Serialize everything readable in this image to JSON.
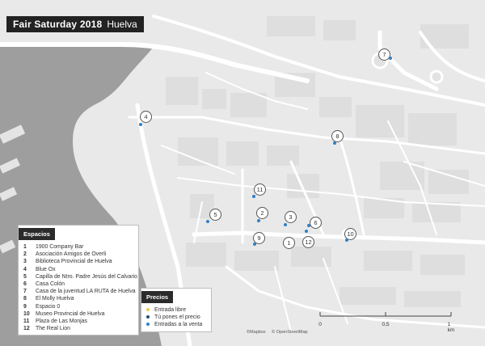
{
  "title": {
    "main": "Fair Saturday 2018",
    "city": "Huelva"
  },
  "legend": {
    "heading": "Espacios",
    "items": [
      {
        "num": "1",
        "name": "1900 Company Bar"
      },
      {
        "num": "2",
        "name": "Asociación Amigos de Overli"
      },
      {
        "num": "3",
        "name": "Biblioteca Provincial de Huelva"
      },
      {
        "num": "4",
        "name": "Blue Ox"
      },
      {
        "num": "5",
        "name": "Capilla de Ntro. Padre Jesús del Calvario"
      },
      {
        "num": "6",
        "name": "Casa Colón"
      },
      {
        "num": "7",
        "name": "Casa de la juventud LA RUTA de Huelva"
      },
      {
        "num": "8",
        "name": "El Molly Huelva"
      },
      {
        "num": "9",
        "name": "Espacio 0"
      },
      {
        "num": "10",
        "name": "Museo Provincial de Huelva"
      },
      {
        "num": "11",
        "name": "Plaza de Las Monjas"
      },
      {
        "num": "12",
        "name": "The Real Lion"
      }
    ]
  },
  "prices": {
    "heading": "Precios",
    "items": [
      {
        "label": "Entrada libre",
        "color": "#f2c94c"
      },
      {
        "label": "Tú pones el precio",
        "color": "#1f4e79"
      },
      {
        "label": "Entradas a la venta",
        "color": "#2f80c6"
      }
    ]
  },
  "markers": [
    {
      "num": "1",
      "price": "Entrada libre"
    },
    {
      "num": "2",
      "price": "Entradas a la venta"
    },
    {
      "num": "3",
      "price": "Entradas a la venta"
    },
    {
      "num": "4",
      "price": "Entradas a la venta"
    },
    {
      "num": "5",
      "price": "Entradas a la venta"
    },
    {
      "num": "6",
      "price": "Entradas a la venta"
    },
    {
      "num": "7",
      "price": "Entradas a la venta"
    },
    {
      "num": "8",
      "price": "Entradas a la venta"
    },
    {
      "num": "9",
      "price": "Entradas a la venta"
    },
    {
      "num": "10",
      "price": "Entradas a la venta"
    },
    {
      "num": "11",
      "price": "Entradas a la venta"
    },
    {
      "num": "12",
      "price": "Entradas a la venta"
    }
  ],
  "scale": {
    "labels": [
      "0",
      "0,5",
      "1 km"
    ]
  },
  "attribution": [
    "©Mapbox",
    "© OpenStreetMap"
  ],
  "colors": {
    "water": "#9e9e9e",
    "land": "#e9e9e9",
    "road": "#ffffff",
    "block": "#dcdcdc",
    "panel_header": "#2b2b2b"
  }
}
